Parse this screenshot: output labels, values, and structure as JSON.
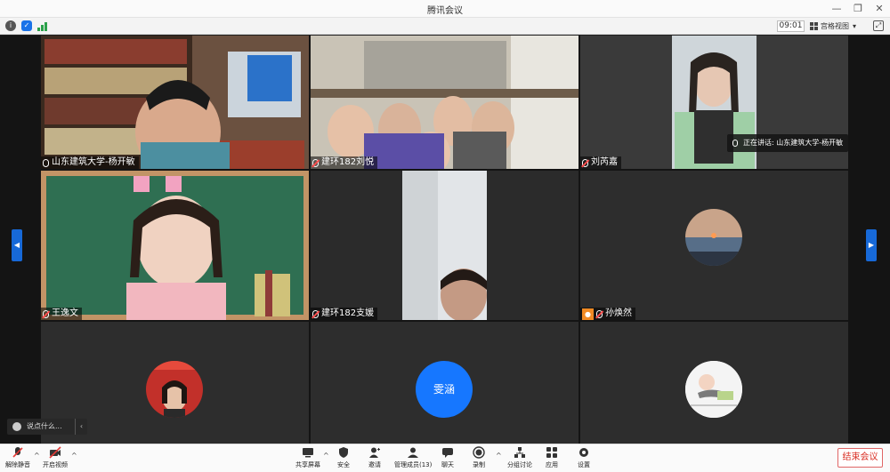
{
  "app": {
    "title": "腾讯会议"
  },
  "infobar": {
    "timer": "09:01",
    "view_label": "宫格视图"
  },
  "participants": [
    {
      "name": "山东建筑大学-杨开敏",
      "mic": "on"
    },
    {
      "name": "建环182刘悦",
      "mic": "muted"
    },
    {
      "name": "刘芮嘉",
      "mic": "muted"
    },
    {
      "name": "王逸文",
      "mic": "muted"
    },
    {
      "name": "建环182支媛",
      "mic": "muted"
    },
    {
      "name": "孙焕然",
      "mic": "muted"
    },
    {
      "name": "",
      "mic": ""
    },
    {
      "name": "雯涵",
      "mic": ""
    },
    {
      "name": "",
      "mic": ""
    }
  ],
  "speaking": {
    "label": "正在讲话: 山东建筑大学-杨开敏"
  },
  "chat": {
    "placeholder": "说点什么..."
  },
  "toolbar": {
    "unmute": "解除静音",
    "start_video": "开启视频",
    "share": "共享屏幕",
    "security": "安全",
    "invite": "邀请",
    "members": "管理成员(13)",
    "chat": "聊天",
    "record": "录制",
    "breakout": "分组讨论",
    "apps": "应用",
    "settings": "设置",
    "end": "结束会议"
  },
  "colors": {
    "accent": "#1769d8",
    "end": "#d93025",
    "avatar_blue": "#1677ff"
  }
}
